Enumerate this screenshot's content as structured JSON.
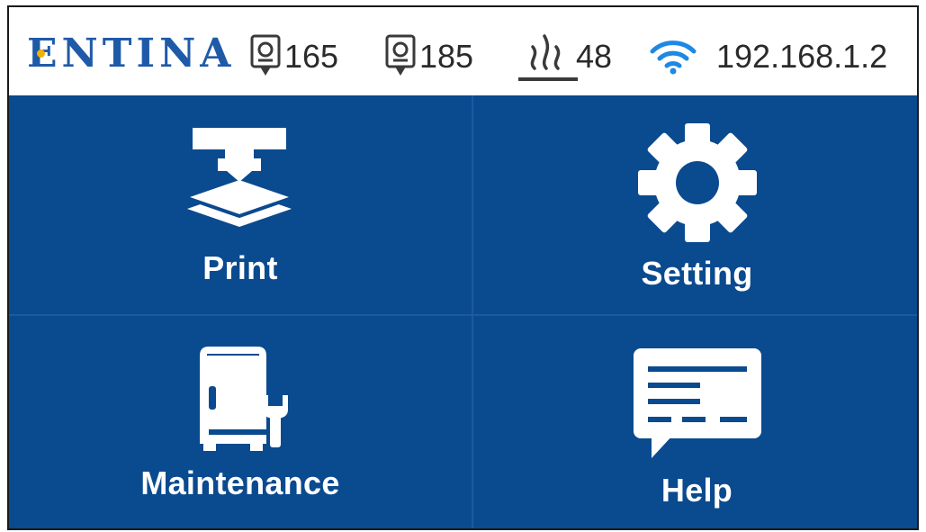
{
  "brand": {
    "logo_text": "ENTINA",
    "logo_color": "#1f5aa8",
    "accent_dot_color": "#f0b400"
  },
  "status": {
    "nozzle1": {
      "icon": "nozzle-icon",
      "value": "165"
    },
    "nozzle2": {
      "icon": "nozzle-icon",
      "value": "185"
    },
    "bed": {
      "icon": "heated-bed-icon",
      "value": "48"
    },
    "network": {
      "icon": "wifi-icon",
      "ip": "192.168.1.2",
      "wifi_color": "#1e88e5"
    }
  },
  "menu": {
    "background_color": "#0a4a8f",
    "items": [
      {
        "label": "Print",
        "icon": "print-icon"
      },
      {
        "label": "Setting",
        "icon": "gear-icon"
      },
      {
        "label": "Maintenance",
        "icon": "maintenance-icon"
      },
      {
        "label": "Help",
        "icon": "help-chat-icon"
      }
    ]
  }
}
